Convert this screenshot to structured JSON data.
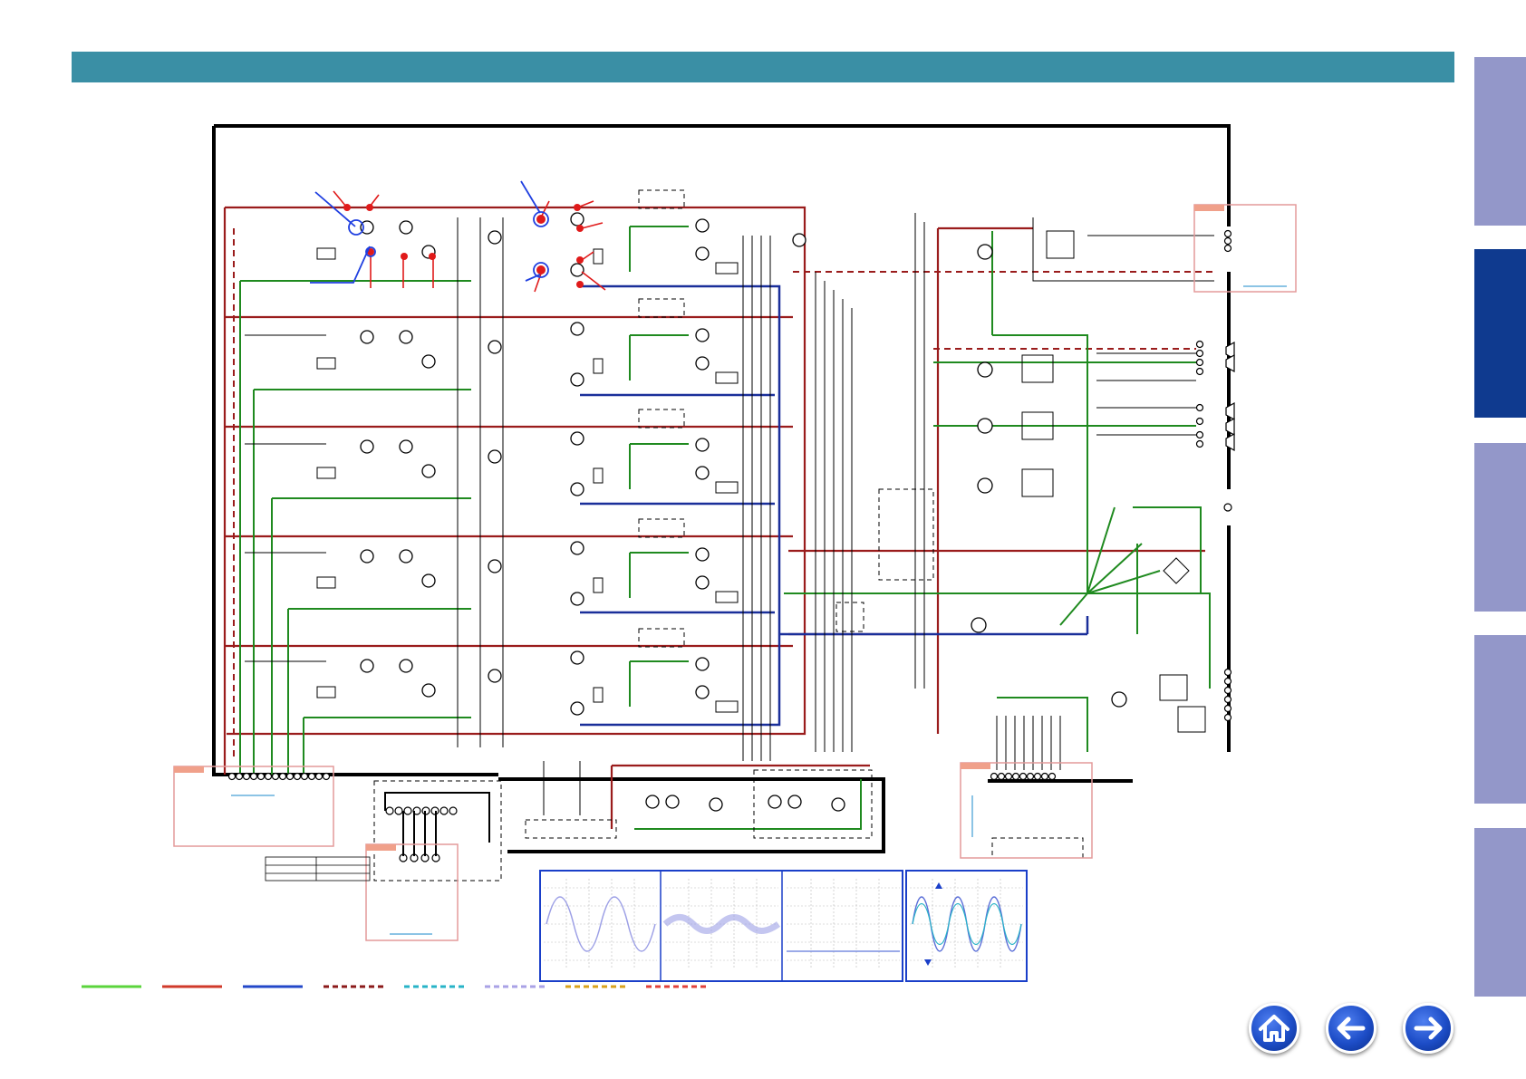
{
  "header": {
    "title": ""
  },
  "side_tabs": [
    {
      "id": "tab-1",
      "label": ""
    },
    {
      "id": "tab-2",
      "label": ""
    },
    {
      "id": "tab-3",
      "label": ""
    },
    {
      "id": "tab-4",
      "label": ""
    },
    {
      "id": "tab-5",
      "label": ""
    }
  ],
  "legend": {
    "lines": [
      {
        "color": "#5bd43c",
        "style": "solid"
      },
      {
        "color": "#d03a2a",
        "style": "solid"
      },
      {
        "color": "#2348c9",
        "style": "solid"
      },
      {
        "color": "#8b1a1a",
        "style": "dashed"
      },
      {
        "color": "#27b3c7",
        "style": "dashed"
      },
      {
        "color": "#a9a2e6",
        "style": "dashed"
      },
      {
        "color": "#d8a21c",
        "style": "dashed"
      },
      {
        "color": "#e0403a",
        "style": "dashed"
      }
    ]
  },
  "nav": {
    "home_icon": "house-icon",
    "back_icon": "arrow-left-icon",
    "next_icon": "arrow-right-icon"
  },
  "colors": {
    "header": "#3a8fa5",
    "tab_inactive": "#9397c9",
    "tab_active": "#0f3a8f",
    "wire_green": "#1f8a1f",
    "wire_red": "#9a1c1c",
    "wire_blue": "#1a2f9a"
  }
}
